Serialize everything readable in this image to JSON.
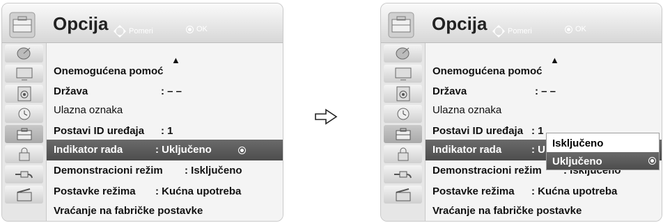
{
  "menu": {
    "title": "Opcija",
    "hint_move": "Pomeri",
    "hint_ok": "OK",
    "categories": [
      "satellite",
      "picture",
      "audio",
      "time",
      "option",
      "lock",
      "input",
      "usb"
    ],
    "active_category": "option",
    "items": [
      {
        "label": "Onemogućena pomoć",
        "value": ""
      },
      {
        "label": "Država",
        "value": ": – –"
      },
      {
        "label": "Ulazna oznaka",
        "value": ""
      },
      {
        "label": "Postavi ID uređaja",
        "value": ": 1"
      },
      {
        "label": "Indikator rada",
        "value": ": Uključeno"
      },
      {
        "label": "Demonstracioni režim",
        "value": ": Isključeno"
      },
      {
        "label": "Postavke režima",
        "value": ": Kućna upotreba"
      },
      {
        "label": "Vraćanje na fabričke postavke",
        "value": ""
      }
    ],
    "partial_value": ": U",
    "partial_value_2": ": Isključeno"
  },
  "popup": {
    "options": [
      "Isključeno",
      "Uključeno"
    ],
    "selected": "Uključeno"
  },
  "colors": {
    "highlight": "#595959",
    "panel_bg": "#f4f4f4"
  }
}
